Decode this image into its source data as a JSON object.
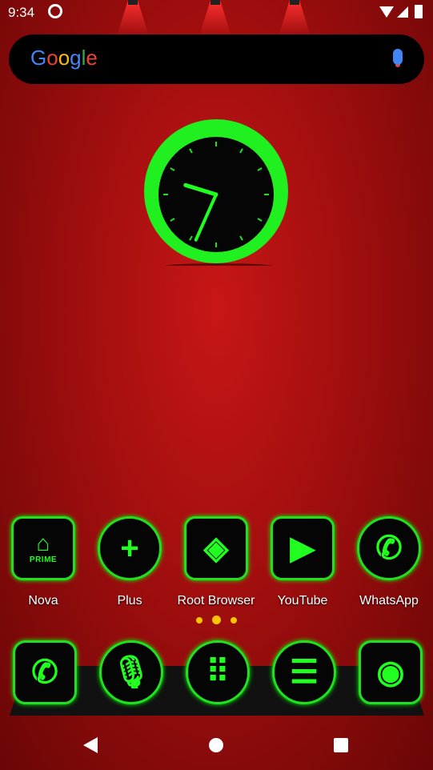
{
  "status": {
    "time": "9:34",
    "icons": [
      "sync-icon",
      "wifi-icon",
      "signal-icon",
      "battery-icon"
    ]
  },
  "search": {
    "logo": "Google",
    "icon": "mic-icon"
  },
  "clock": {
    "hour": 9,
    "minute": 34,
    "accent": "#20ff20"
  },
  "apps": [
    {
      "label": "Nova",
      "icon": "nova-prime-icon",
      "badge": "PRIME"
    },
    {
      "label": "Plus",
      "icon": "plus-icon"
    },
    {
      "label": "Root Browser",
      "icon": "root-browser-icon"
    },
    {
      "label": "YouTube",
      "icon": "youtube-icon"
    },
    {
      "label": "WhatsApp",
      "icon": "whatsapp-icon"
    }
  ],
  "page_indicator": {
    "pages": 3,
    "current": 2
  },
  "dock": [
    {
      "icon": "phone-icon"
    },
    {
      "icon": "voice-search-icon"
    },
    {
      "icon": "app-drawer-icon"
    },
    {
      "icon": "messages-icon"
    },
    {
      "icon": "camera-icon"
    }
  ],
  "nav": [
    "back-icon",
    "home-icon",
    "recents-icon"
  ]
}
